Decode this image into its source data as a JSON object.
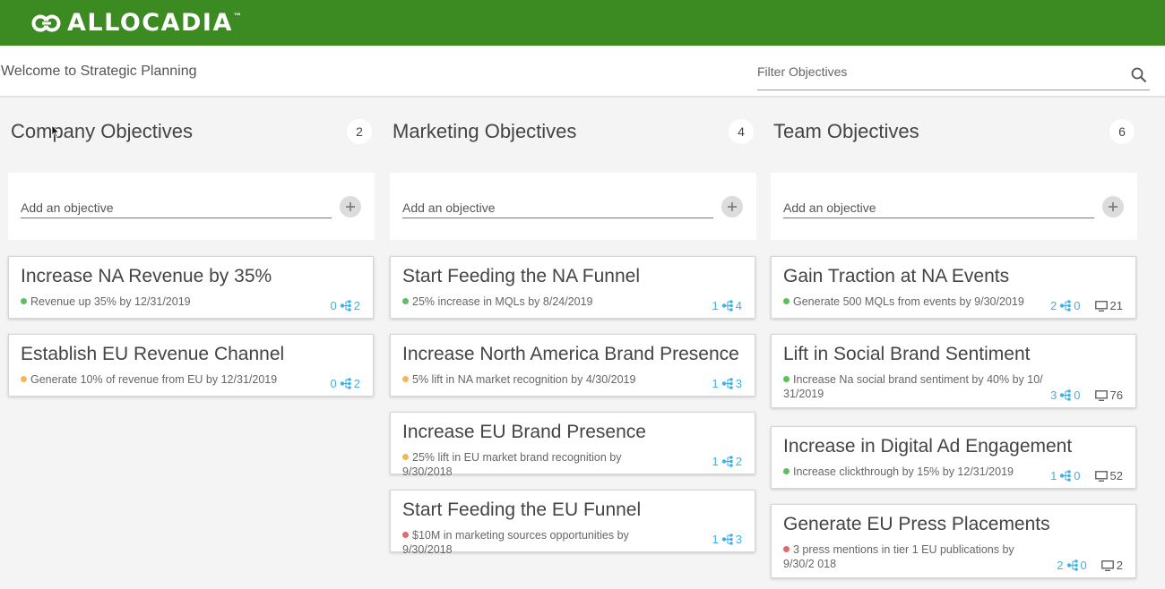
{
  "brand": {
    "name": "ALLOCADIA",
    "tm": "™",
    "color": "#3b8a22"
  },
  "subheader": {
    "welcome": "Welcome to Strategic Planning",
    "filter_placeholder": "Filter Objectives"
  },
  "status_colors": {
    "green": "#5cc15a",
    "yellow": "#f0b954",
    "red": "#e06a6a"
  },
  "columns": [
    {
      "title": "Company Objectives",
      "count": "2",
      "add_placeholder": "Add an objective",
      "cards": [
        {
          "title": "Increase NA Revenue by 35%",
          "sub": "Revenue up 35% by 12/31/2019",
          "status": "green",
          "left": "0",
          "right": "2"
        },
        {
          "title": "Establish EU Revenue Channel",
          "sub": "Generate 10% of revenue from EU by 12/31/2019",
          "status": "yellow",
          "left": "0",
          "right": "2"
        }
      ]
    },
    {
      "title": "Marketing Objectives",
      "count": "4",
      "add_placeholder": "Add an objective",
      "cards": [
        {
          "title": "Start Feeding the NA Funnel",
          "sub": "25% increase in MQLs by 8/24/2019",
          "status": "green",
          "left": "1",
          "right": "4"
        },
        {
          "title": "Increase North America Brand Presence",
          "sub": "5% lift in NA market recognition by 4/30/2019",
          "status": "yellow",
          "left": "1",
          "right": "3"
        },
        {
          "title": "Increase EU Brand Presence",
          "sub": "25% lift in EU market brand recognition by 9/30/2018",
          "status": "yellow",
          "left": "1",
          "right": "2"
        },
        {
          "title": "Start Feeding the EU Funnel",
          "sub": "$10M in marketing sources opportunities by 9/30/2018",
          "status": "red",
          "left": "1",
          "right": "3"
        }
      ]
    },
    {
      "title": "Team Objectives",
      "count": "6",
      "add_placeholder": "Add an objective",
      "cards": [
        {
          "title": "Gain Traction at NA Events",
          "sub": "Generate 500 MQLs from events by 9/30/2019",
          "status": "green",
          "left": "2",
          "right": "0",
          "views": "21"
        },
        {
          "title": "Lift in Social Brand Sentiment",
          "sub": "Increase Na social brand sentiment by 40% by 10/ 31/2019",
          "status": "green",
          "left": "3",
          "right": "0",
          "views": "76",
          "tall": true
        },
        {
          "title": "Increase in Digital Ad Engagement",
          "sub": "Increase clickthrough by 15% by 12/31/2019",
          "status": "green",
          "left": "1",
          "right": "0",
          "views": "52"
        },
        {
          "title": "Generate EU Press Placements",
          "sub": "3 press mentions in tier 1 EU publications by 9/30/2 018",
          "status": "red",
          "left": "2",
          "right": "0",
          "views": "2",
          "tall": true
        }
      ]
    }
  ]
}
